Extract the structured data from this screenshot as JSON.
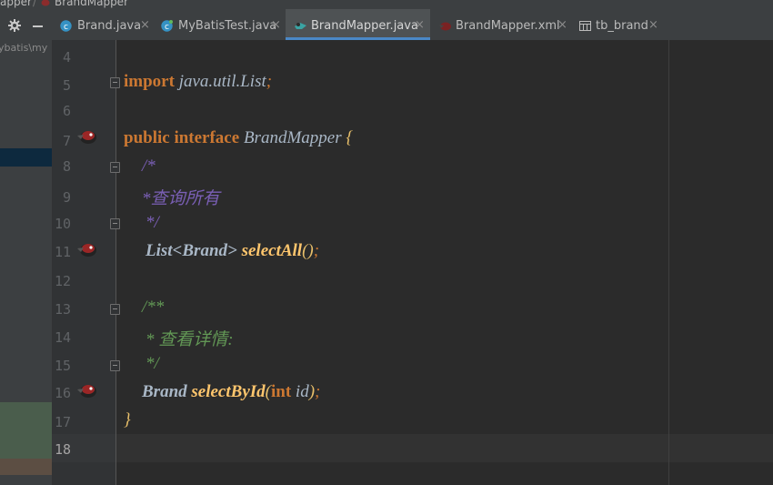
{
  "breadcrumb": {
    "module": "apper",
    "separator": "/",
    "file": "BrandMapper",
    "file_icon": "mybatis-bird-icon"
  },
  "project_panel": {
    "path_text": "ybatis\\my",
    "gear_icon": "gear-icon",
    "collapse_icon": "minus-icon"
  },
  "tabs": [
    {
      "label": "Brand.java",
      "icon": "java-class-icon",
      "close": "×",
      "active": false
    },
    {
      "label": "MyBatisTest.java",
      "icon": "java-class-icon",
      "close": "×",
      "active": false
    },
    {
      "label": "BrandMapper.java",
      "icon": "mybatis-interface-icon",
      "close": "×",
      "active": true
    },
    {
      "label": "BrandMapper.xml",
      "icon": "mybatis-bird-icon",
      "close": "×",
      "active": false
    },
    {
      "label": "tb_brand",
      "icon": "table-icon",
      "close": "×",
      "active": false
    }
  ],
  "editor": {
    "current_line": "18",
    "line_numbers": [
      "4",
      "5",
      "6",
      "7",
      "8",
      "9",
      "10",
      "11",
      "12",
      "13",
      "14",
      "15",
      "16",
      "17",
      "18"
    ],
    "code": {
      "l5": {
        "kw": "import",
        "pkg": "java.util.List",
        "semi": ";"
      },
      "l7": {
        "kw": "public interface",
        "name": "BrandMapper",
        "brace": "{"
      },
      "l8": {
        "text": "/*"
      },
      "l9": {
        "text": "*查询所有"
      },
      "l10": {
        "text": "*/"
      },
      "l11": {
        "type": "List<Brand>",
        "method": "selectAll",
        "parens": "()",
        "semi": ";"
      },
      "l13": {
        "text": "/**"
      },
      "l14": {
        "text": "* 查看详情:"
      },
      "l15": {
        "text": "*/"
      },
      "l16": {
        "type": "Brand",
        "method": "selectById",
        "open": "(",
        "kw": "int",
        "param": "id",
        "close": ")",
        "semi": ";"
      },
      "l17": {
        "brace": "}"
      }
    },
    "gutter_icons": [
      "mybatis-bird-icon",
      "mybatis-bird-icon",
      "mybatis-bird-icon"
    ]
  },
  "colors": {
    "background": "#2b2b2b",
    "keyword": "#cc7832",
    "method": "#ffc66d",
    "comment_block": "#7a5fb5",
    "comment_doc": "#629755",
    "active_tab_underline": "#4a88c7"
  }
}
